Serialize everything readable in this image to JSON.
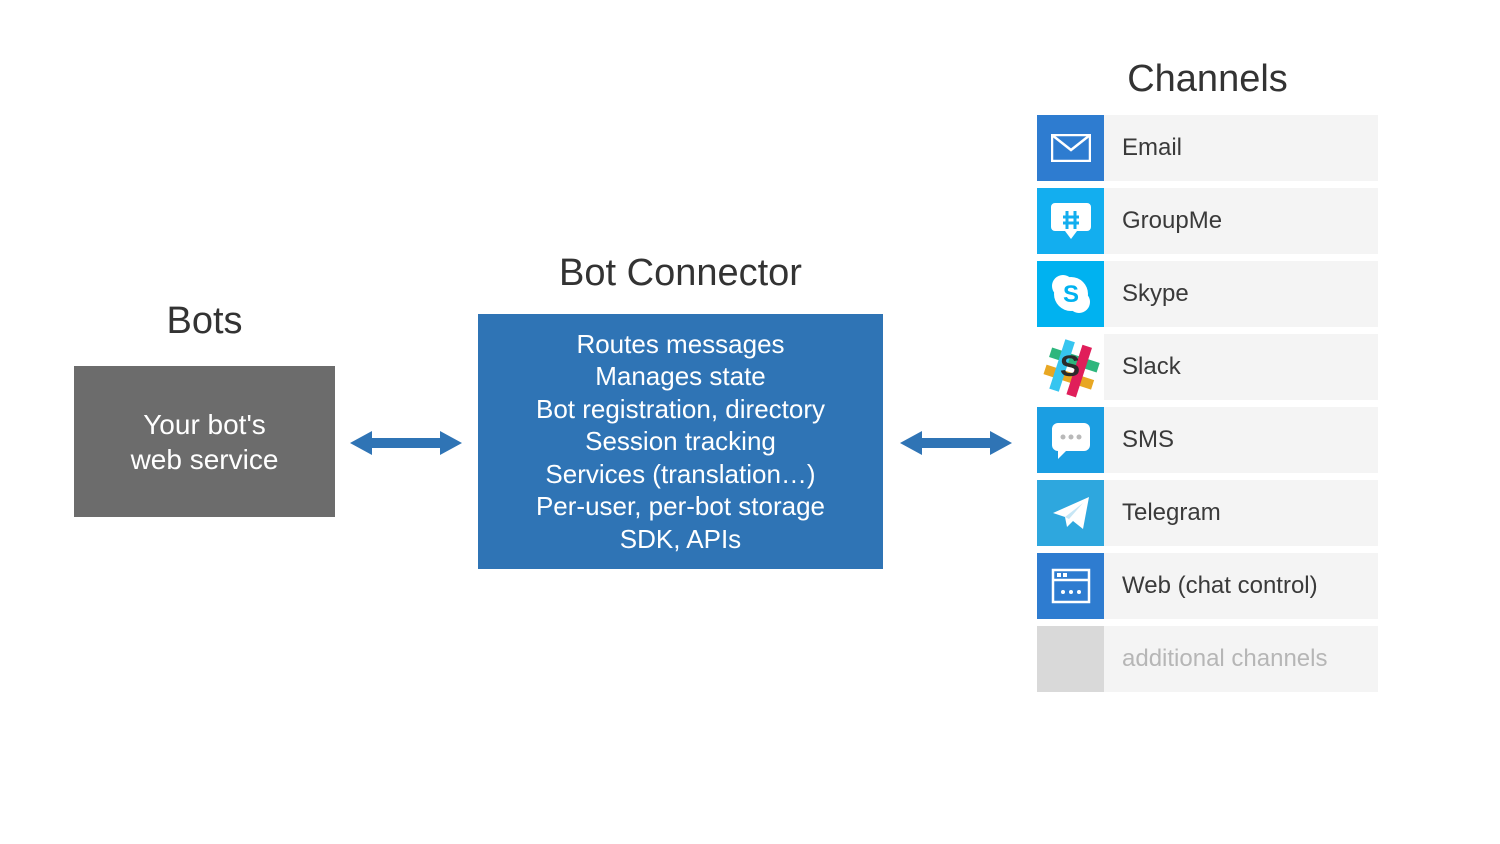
{
  "bots": {
    "title": "Bots",
    "box_line1": "Your bot's",
    "box_line2": "web service"
  },
  "connector": {
    "title": "Bot Connector",
    "lines": [
      "Routes messages",
      "Manages state",
      "Bot registration, directory",
      "Session tracking",
      "Services (translation…)",
      "Per-user, per-bot storage",
      "SDK, APIs"
    ]
  },
  "channels": {
    "title": "Channels",
    "items": [
      {
        "label": "Email",
        "icon": "email"
      },
      {
        "label": "GroupMe",
        "icon": "groupme"
      },
      {
        "label": "Skype",
        "icon": "skype"
      },
      {
        "label": "Slack",
        "icon": "slack"
      },
      {
        "label": "SMS",
        "icon": "sms"
      },
      {
        "label": "Telegram",
        "icon": "telegram"
      },
      {
        "label": "Web (chat control)",
        "icon": "web"
      },
      {
        "label": "additional channels",
        "icon": "blank",
        "muted": true
      }
    ]
  },
  "colors": {
    "connector_bg": "#2f74b5",
    "bots_bg": "#6c6c6c",
    "arrow": "#2f74b5"
  }
}
